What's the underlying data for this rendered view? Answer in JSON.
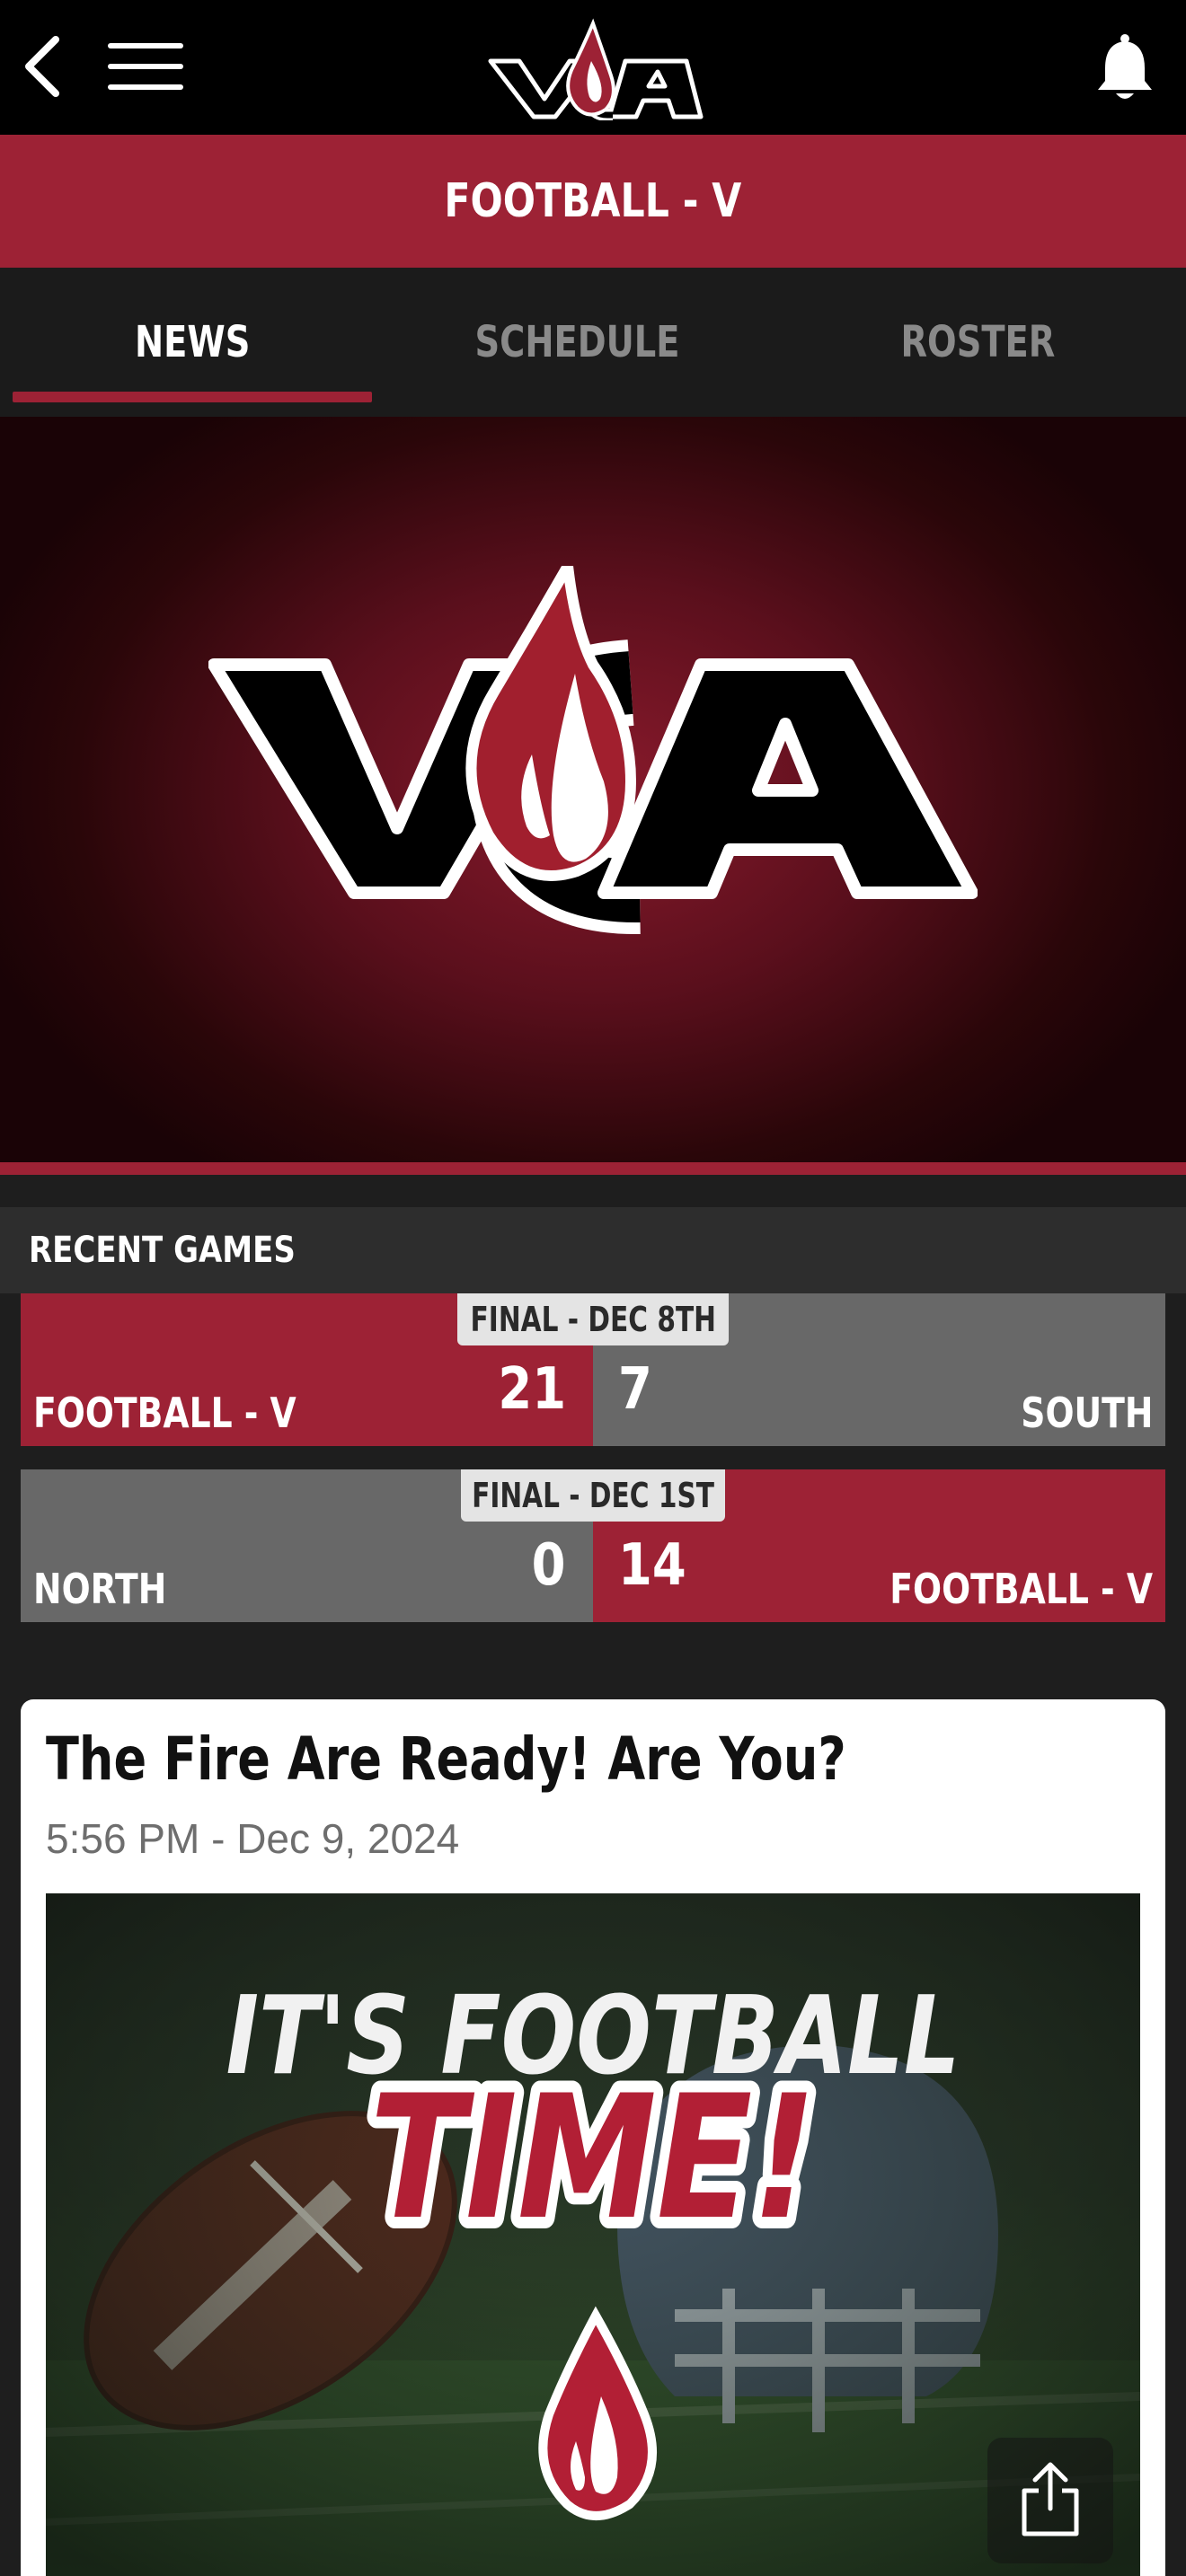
{
  "header": {
    "logo_text": "VCA",
    "back_icon": "chevron-left-icon",
    "menu_icon": "hamburger-menu-icon",
    "notifications_icon": "bell-icon"
  },
  "team": {
    "title": "FOOTBALL - V"
  },
  "tabs": [
    {
      "label": "NEWS",
      "active": true
    },
    {
      "label": "SCHEDULE",
      "active": false
    },
    {
      "label": "ROSTER",
      "active": false
    }
  ],
  "hero": {
    "logo_text": "VCA"
  },
  "recent_games": {
    "heading": "RECENT GAMES",
    "games": [
      {
        "status": "FINAL - DEC 8TH",
        "left_team": "FOOTBALL - V",
        "left_score": "21",
        "right_team": "SOUTH",
        "right_score": "7",
        "winner": "left"
      },
      {
        "status": "FINAL - DEC 1ST",
        "left_team": "NORTH",
        "left_score": "0",
        "right_team": "FOOTBALL - V",
        "right_score": "14",
        "winner": "right"
      }
    ]
  },
  "news": [
    {
      "title": "The Fire Are Ready! Are You?",
      "timestamp": "5:56 PM - Dec 9, 2024",
      "image_text_line1": "IT'S FOOTBALL",
      "image_text_line2": "TIME!"
    }
  ],
  "share_icon": "share-icon",
  "colors": {
    "brand_red": "#9d2235",
    "loss_gray": "#686868",
    "bar_black": "#000000",
    "background": "#1e1e1e"
  }
}
